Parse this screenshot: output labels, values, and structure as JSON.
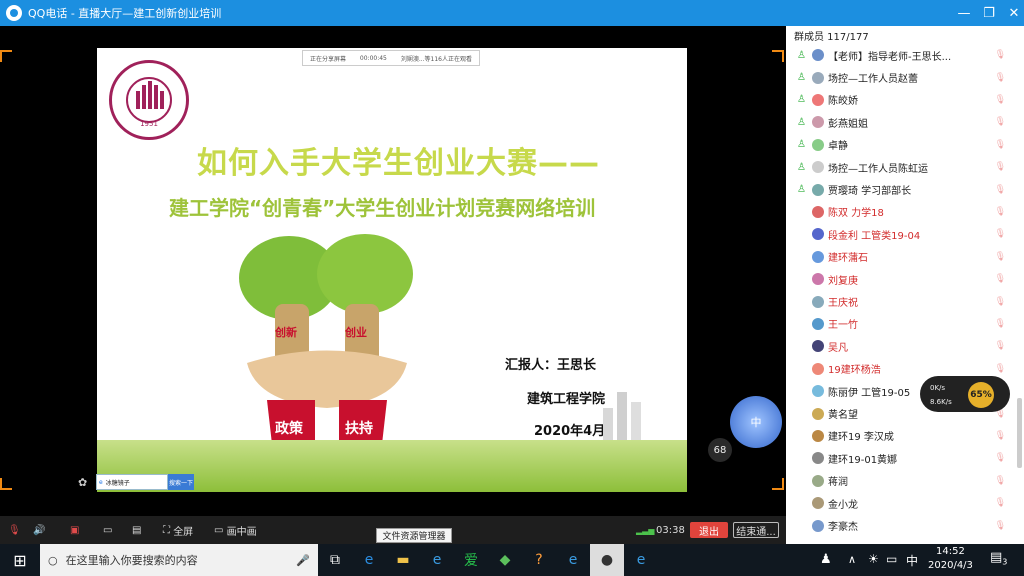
{
  "window": {
    "title": "QQ电话 - 直播大厅—建工创新创业培训"
  },
  "share_bar": {
    "status": "正在分享屏幕",
    "time": "00:00:45",
    "viewers": "刘娴澳...等116人正在观看"
  },
  "slide": {
    "seal_year": "1951",
    "title": "如何入手大学生创业大赛——",
    "subtitle": "建工学院“创青春”大学生创业计划竞赛网络培训",
    "tree_labels": [
      "创新",
      "创业"
    ],
    "sign_labels": [
      "政策",
      "扶持"
    ],
    "reporter": "汇报人：王思长",
    "school": "建筑工程学院",
    "date": "2020年4月"
  },
  "overlay_search": {
    "placeholder": "冰糖镜子",
    "button": "搜索一下"
  },
  "live_badge": {
    "count": "68",
    "text": "中"
  },
  "controls": {
    "fullscreen": "全屏",
    "pip": "画中画",
    "duration": "03:38",
    "exit": "退出",
    "end": "结束通..."
  },
  "tooltip": "文件资源管理器",
  "members": {
    "header": "群成员 117/177",
    "list": [
      {
        "name": "【老师】指导老师-王思长...",
        "color": "#222222"
      },
      {
        "name": "场控—工作人员赵蕾",
        "color": "#222222"
      },
      {
        "name": "陈皎娇",
        "color": "#222222"
      },
      {
        "name": "彭燕姐姐",
        "color": "#222222"
      },
      {
        "name": "卓静",
        "color": "#222222"
      },
      {
        "name": "场控—工作人员陈虹运",
        "color": "#222222"
      },
      {
        "name": "贾璎琦  学习部部长",
        "color": "#222222"
      },
      {
        "name": "陈双 力学18",
        "color": "#d22b2b"
      },
      {
        "name": "段金利 工管类19-04",
        "color": "#d22b2b"
      },
      {
        "name": "建环蒲石",
        "color": "#d22b2b"
      },
      {
        "name": "刘复庚",
        "color": "#d22b2b"
      },
      {
        "name": "王庆祝",
        "color": "#d22b2b"
      },
      {
        "name": "王一竹",
        "color": "#d22b2b"
      },
      {
        "name": "吴凡",
        "color": "#d22b2b"
      },
      {
        "name": "19建环杨浩",
        "color": "#d22b2b"
      },
      {
        "name": "陈丽伊 工管19-05",
        "color": "#222222"
      },
      {
        "name": "黄名望",
        "color": "#222222"
      },
      {
        "name": "建环19 李汉成",
        "color": "#222222"
      },
      {
        "name": "建环19-01黄娜",
        "color": "#222222"
      },
      {
        "name": "蒋润",
        "color": "#222222"
      },
      {
        "name": "金小龙",
        "color": "#222222"
      },
      {
        "name": "李豪杰",
        "color": "#222222"
      }
    ]
  },
  "speed_widget": {
    "up": "0K/s",
    "down": "8.6K/s",
    "percent": "65%"
  },
  "taskbar": {
    "search_placeholder": "在这里输入你要搜索的内容",
    "ime": "中",
    "time": "14:52",
    "date": "2020/4/3",
    "notifications": "3"
  }
}
